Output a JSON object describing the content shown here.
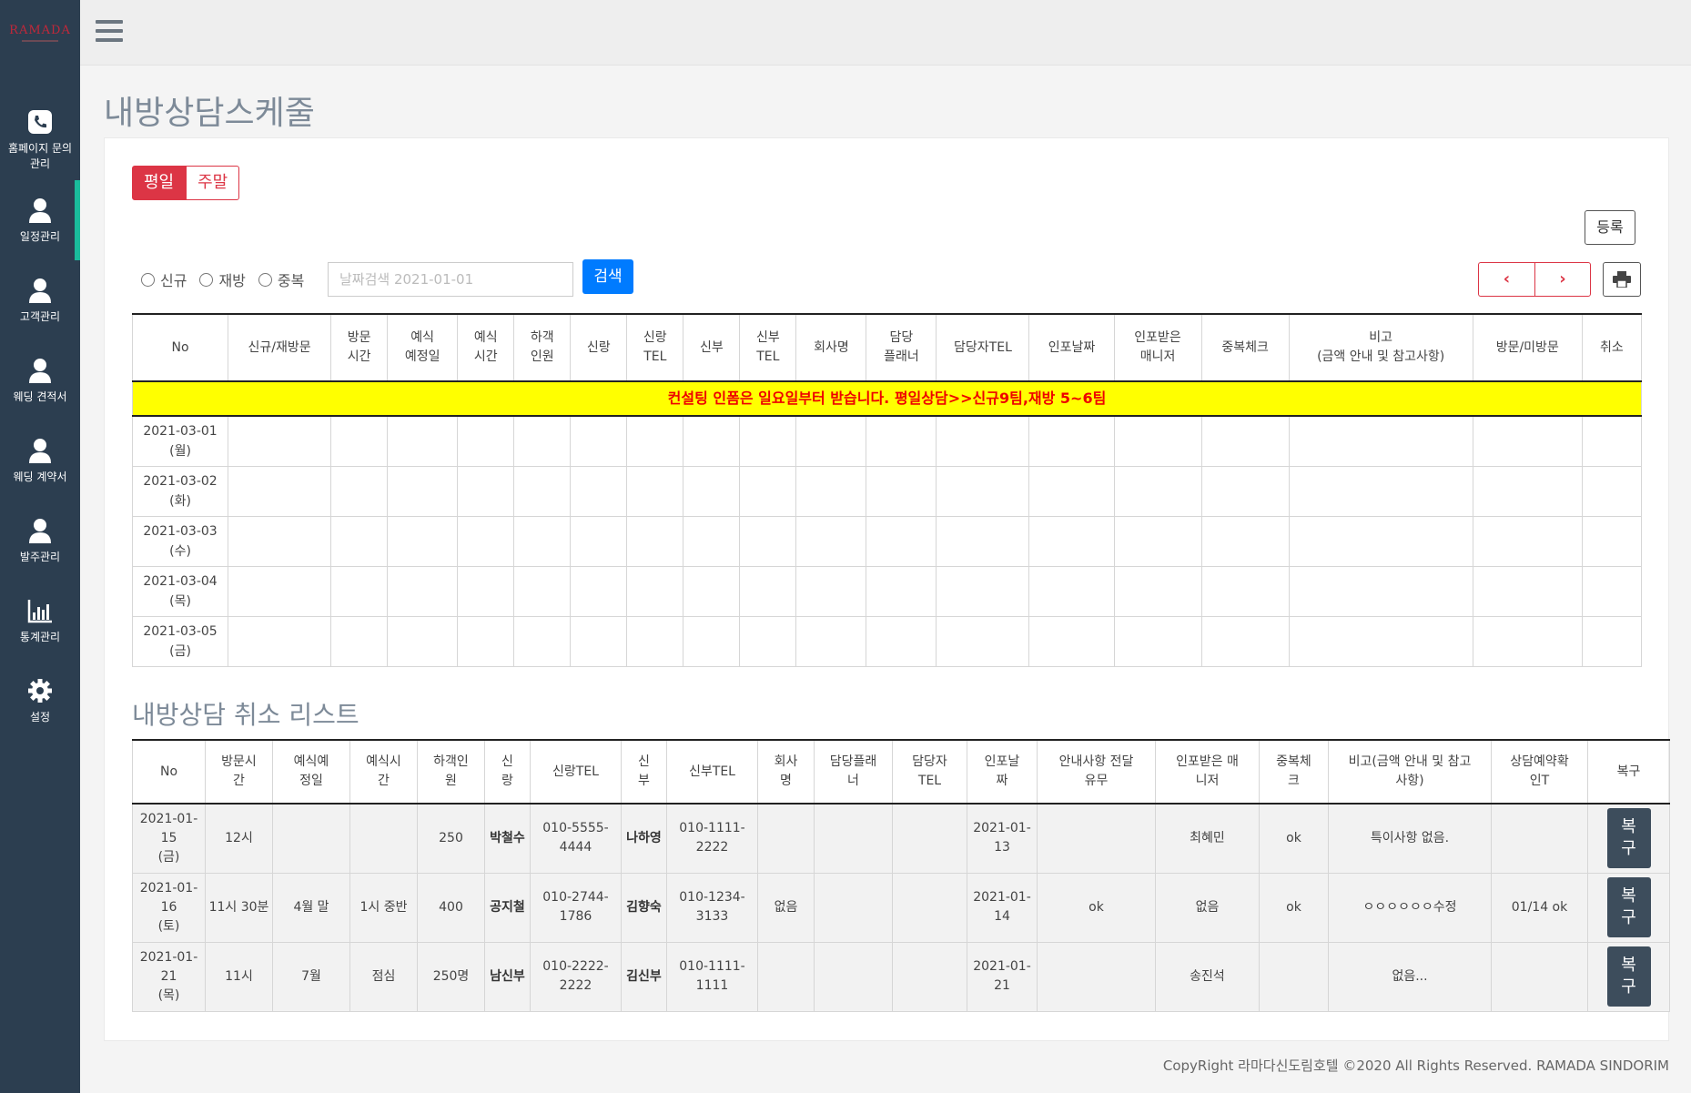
{
  "logo": {
    "text": "RAMADA"
  },
  "sidebar": {
    "items": [
      {
        "label": "홈페이지 문의\n관리",
        "icon": "phone-icon"
      },
      {
        "label": "일정관리",
        "icon": "user-icon"
      },
      {
        "label": "고객관리",
        "icon": "user-icon"
      },
      {
        "label": "웨딩 견적서",
        "icon": "user-icon"
      },
      {
        "label": "웨딩 계약서",
        "icon": "user-icon"
      },
      {
        "label": "발주관리",
        "icon": "user-icon"
      },
      {
        "label": "통계관리",
        "icon": "bar-chart-icon"
      },
      {
        "label": "설정",
        "icon": "gear-icon"
      }
    ]
  },
  "page": {
    "title": "내방상담스케줄"
  },
  "toggle": {
    "weekday": "평일",
    "weekend": "주말"
  },
  "register_label": "등록",
  "filters": {
    "radios": [
      "신규",
      "재방",
      "중복"
    ],
    "date_placeholder": "날짜검색 2021-01-01",
    "search_label": "검색"
  },
  "pager": {
    "prev": "‹",
    "next": "›"
  },
  "schedule": {
    "headers": [
      "No",
      "신규/재방문",
      "방문\n시간",
      "예식\n예정일",
      "예식\n시간",
      "하객\n인원",
      "신랑",
      "신랑\nTEL",
      "신부",
      "신부\nTEL",
      "회사명",
      "담당\n플래너",
      "담당자TEL",
      "인포날짜",
      "인포받은\n매니저",
      "중복체크",
      "비고\n(금액 안내 및 참고사항)",
      "방문/미방문",
      "취소"
    ],
    "notice": "컨설팅 인폼은 일요일부터 받습니다.  평일상담>>신규9팀,재방 5~6팀",
    "rows": [
      "2021-03-01\n(월)",
      "2021-03-02\n(화)",
      "2021-03-03\n(수)",
      "2021-03-04\n(목)",
      "2021-03-05\n(금)"
    ]
  },
  "cancel": {
    "title": "내방상담 취소 리스트",
    "headers": [
      "No",
      "방문시\n간",
      "예식예\n정일",
      "예식시\n간",
      "하객인\n원",
      "신\n랑",
      "신랑TEL",
      "신\n부",
      "신부TEL",
      "회사\n명",
      "담당플래\n너",
      "담당자\nTEL",
      "인포날\n짜",
      "안내사항 전달\n유무",
      "인포받은 매\n니저",
      "중복체\n크",
      "비고(금액 안내 및 참고\n사항)",
      "상담예약확\n인T",
      "복구"
    ],
    "rows": [
      [
        "2021-01-\n15\n(금)",
        "12시",
        "",
        "",
        "250",
        "박철수",
        "010-5555-\n4444",
        "나하영",
        "010-1111-\n2222",
        "",
        "",
        "",
        "2021-01-\n13",
        "",
        "최혜민",
        "ok",
        "특이사항 없음.",
        ""
      ],
      [
        "2021-01-\n16\n(토)",
        "11시 30분",
        "4월 말",
        "1시 중반",
        "400",
        "공지철",
        "010-2744-\n1786",
        "김향숙",
        "010-1234-\n3133",
        "없음",
        "",
        "",
        "2021-01-\n14",
        "ok",
        "없음",
        "ok",
        "ㅇㅇㅇㅇㅇㅇ수정",
        "01/14 ok"
      ],
      [
        "2021-01-\n21\n(목)",
        "11시",
        "7월",
        "점심",
        "250명",
        "남신부",
        "010-2222-\n2222",
        "김신부",
        "010-1111-\n1111",
        "",
        "",
        "",
        "2021-01-\n21",
        "",
        "송진석",
        "",
        "없음...",
        ""
      ]
    ],
    "restore_label": "복\n구"
  },
  "footer": "CopyRight 라마다신도림호텔 ©2020 All Rights Reserved. RAMADA SINDORIM"
}
